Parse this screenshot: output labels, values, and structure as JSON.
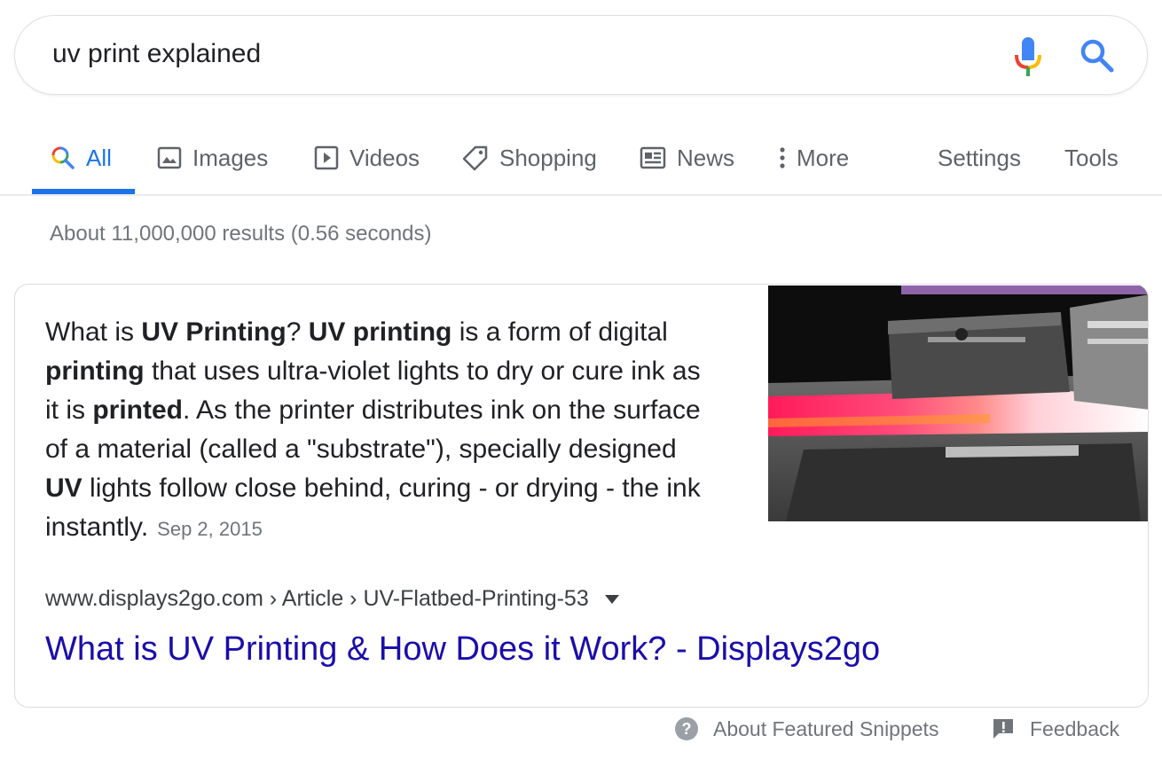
{
  "search": {
    "query": "uv print explained"
  },
  "icons": {
    "mic": "microphone-icon",
    "search": "search-icon"
  },
  "tabs": [
    {
      "label": "All",
      "icon": "search-multicolor-icon",
      "active": true
    },
    {
      "label": "Images",
      "icon": "image-icon"
    },
    {
      "label": "Videos",
      "icon": "video-icon"
    },
    {
      "label": "Shopping",
      "icon": "tag-icon"
    },
    {
      "label": "News",
      "icon": "newspaper-icon"
    },
    {
      "label": "More",
      "icon": "more-vert-icon"
    }
  ],
  "tools": {
    "settings": "Settings",
    "tools": "Tools"
  },
  "stats": "About 11,000,000 results (0.56 seconds)",
  "snippet": {
    "parts": [
      "What is ",
      "UV Printing",
      "? ",
      "UV printing",
      " is a form of digital ",
      "printing",
      " that uses ultra-violet lights to dry or cure ink as it is ",
      "printed",
      ". As the printer distributes ink on the surface of a material (called a \"substrate\"), specially designed ",
      "UV",
      " lights follow close behind, curing - or drying - the ink instantly."
    ],
    "date": "Sep 2, 2015"
  },
  "result": {
    "breadcrumb": "www.displays2go.com › Article › UV-Flatbed-Printing-53",
    "title": "What is UV Printing & How Does it Work? - Displays2go"
  },
  "footer": {
    "about": "About Featured Snippets",
    "feedback": "Feedback"
  },
  "colors": {
    "accent": "#1a73e8",
    "link": "#1a0dab",
    "muted": "#70757a"
  }
}
